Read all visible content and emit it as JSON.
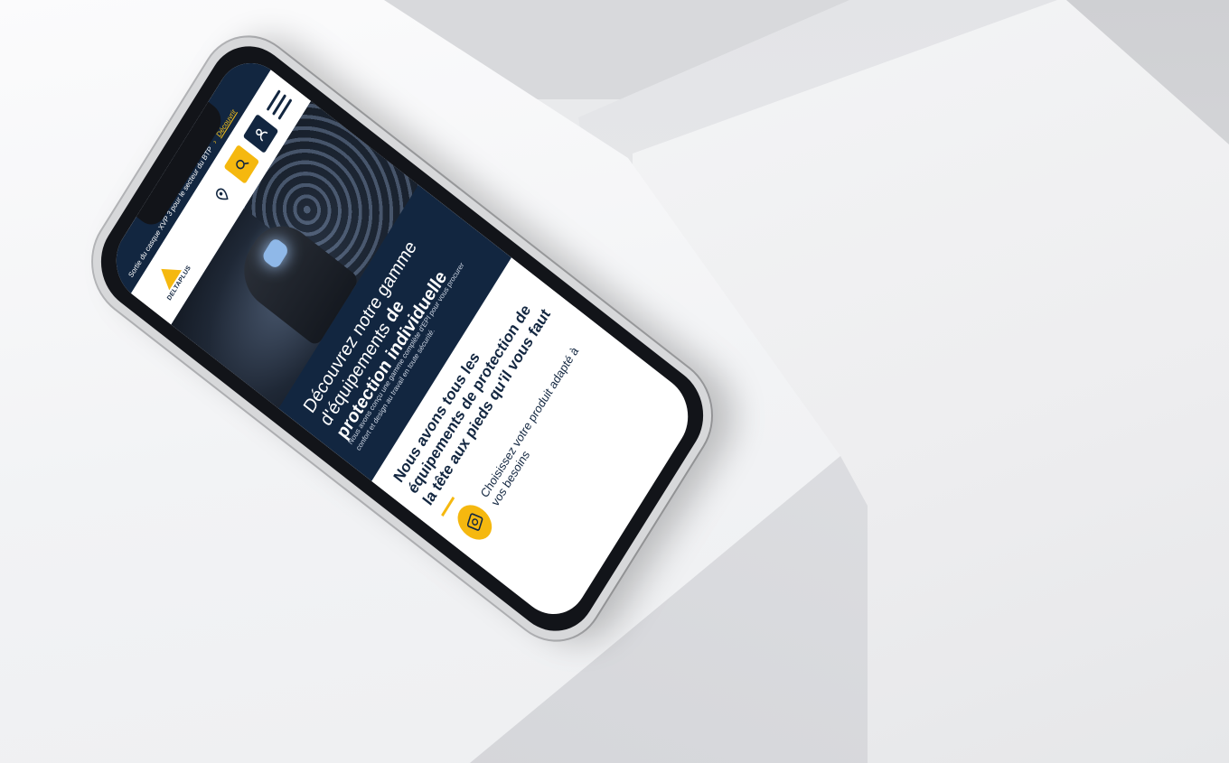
{
  "promo": {
    "text": "Sortie du casque XVP 3 pour le secteur du BTP",
    "arrow": "›",
    "link": "Découvrir"
  },
  "header": {
    "logo_text": "DELTAPLUS",
    "icons": [
      "map-pin-icon",
      "search-icon",
      "user-icon",
      "menu-icon"
    ]
  },
  "hero": {
    "title_light": "Découvrez notre gamme d'équipements ",
    "title_bold": "de protection individuelle",
    "subtitle": "Nous avons conçu une gamme complète d'EPI pour vous procurer confort et design au travail en toute sécurité."
  },
  "section": {
    "title": "Nous avons tous les équipements de protection de la tête aux pieds qu'il vous faut",
    "choose_text": "Choisissez votre produit adapté à vos besoins"
  },
  "colors": {
    "navy": "#122640",
    "yellow": "#f5b80f"
  }
}
